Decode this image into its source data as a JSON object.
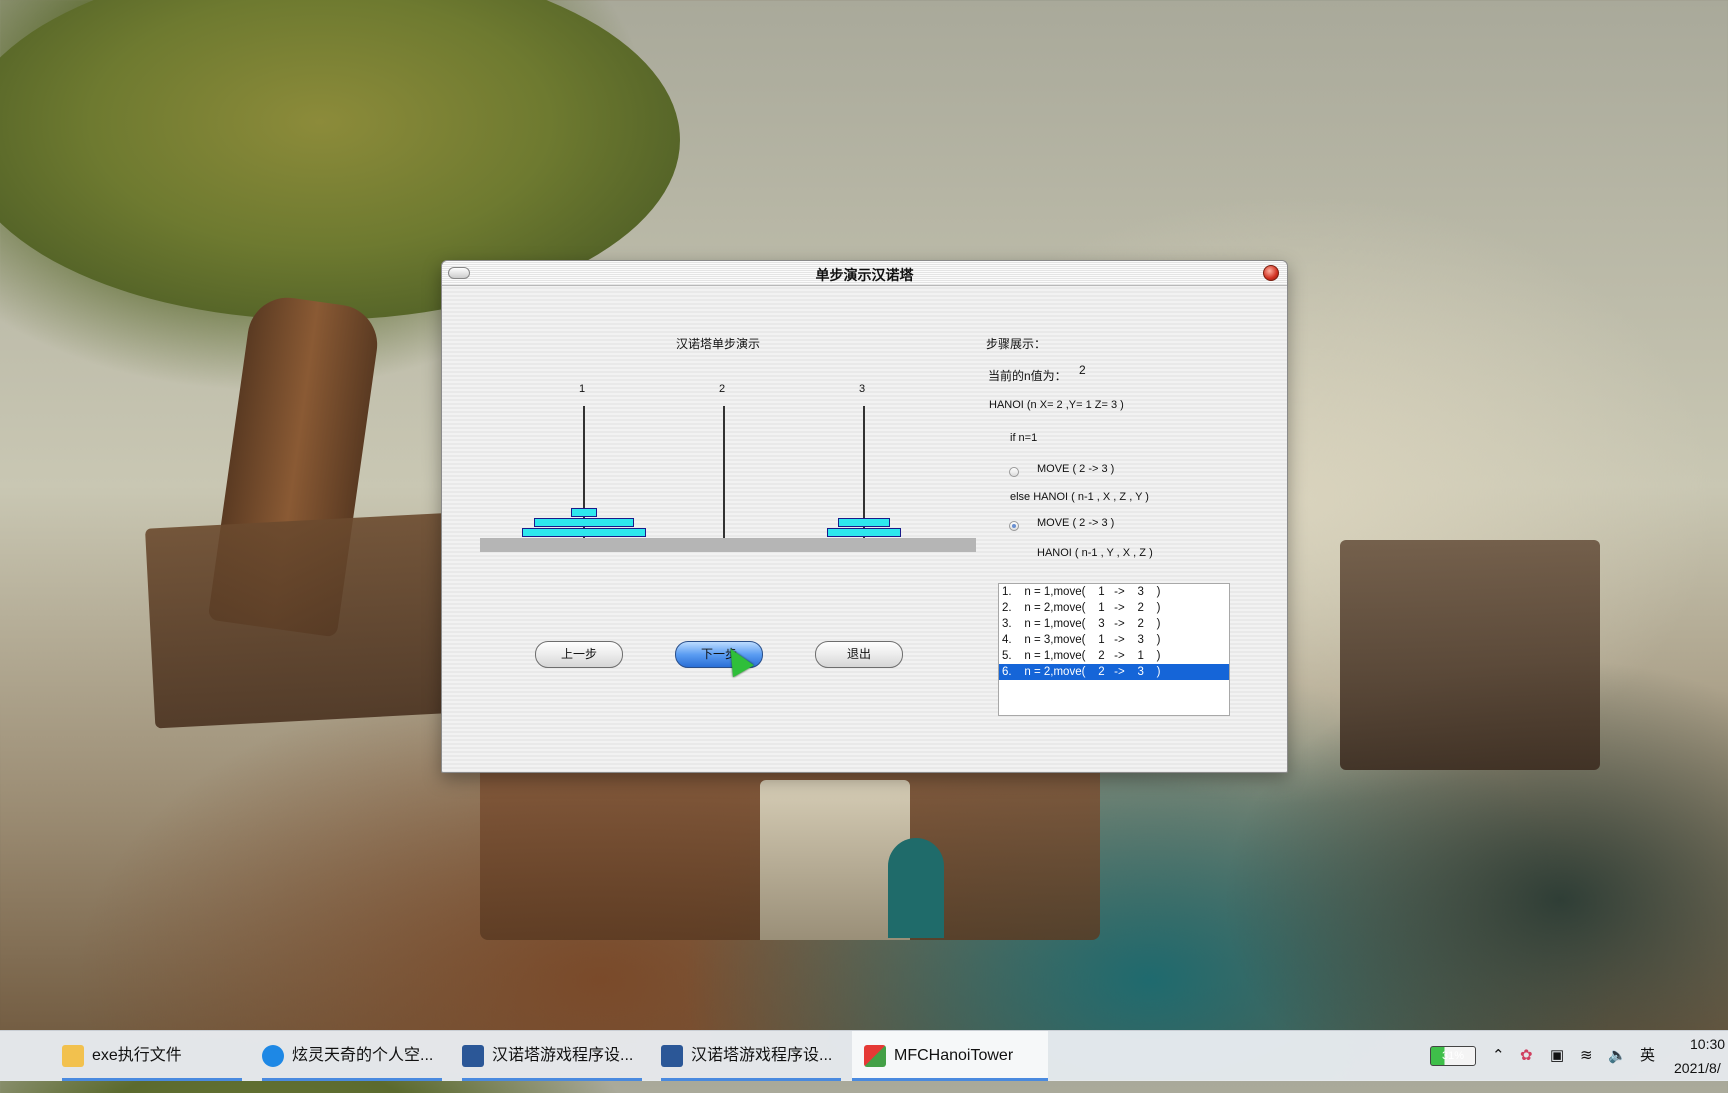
{
  "dialog": {
    "title": "单步演示汉诺塔",
    "demo_title": "汉诺塔单步演示",
    "rod_labels": [
      "1",
      "2",
      "3"
    ],
    "buttons": {
      "prev": "上一步",
      "next": "下一步",
      "exit": "退出"
    },
    "steps_label": "步骤展示：",
    "current_n_label": "当前的n值为：",
    "current_n_value": "2",
    "hanoi_line": "HANOI (n  X=   2      ,Y=   1      Z=    3      )",
    "if_line": "if  n=1",
    "move_line_1": "MOVE (   2        ->     3      )",
    "else_line": "else HANOI ( n-1 , X , Z , Y )",
    "move_line_2": "MOVE (   2        ->     3      )",
    "hanoi_line_2": "HANOI ( n-1 , Y , X , Z )",
    "radio_if_selected": false,
    "radio_else_selected": true,
    "steps": [
      "1.    n = 1,move(    1   ->    3    )",
      "2.    n = 2,move(    1   ->    2    )",
      "3.    n = 1,move(    3   ->    2    )",
      "4.    n = 3,move(    1   ->    3    )",
      "5.    n = 1,move(    2   ->    1    )",
      "6.    n = 2,move(    2   ->    3    )"
    ],
    "selected_step": 5,
    "tower_state": {
      "rod1": [
        "small",
        "medium",
        "large"
      ],
      "rod2": [],
      "rod3": [
        "small",
        "medium"
      ]
    },
    "disk_color": "#2ee8ee"
  },
  "taskbar": {
    "items": [
      {
        "label": "exe执行文件",
        "icon": "folder-icon"
      },
      {
        "label": "炫灵天奇的个人空...",
        "icon": "browser-icon"
      },
      {
        "label": "汉诺塔游戏程序设...",
        "icon": "word-icon"
      },
      {
        "label": "汉诺塔游戏程序设...",
        "icon": "word-icon"
      },
      {
        "label": "MFCHanoiTower",
        "icon": "mfc-app-icon"
      }
    ],
    "battery": "31%",
    "ime": "英",
    "time": "10:30",
    "date": "2021/8/"
  }
}
